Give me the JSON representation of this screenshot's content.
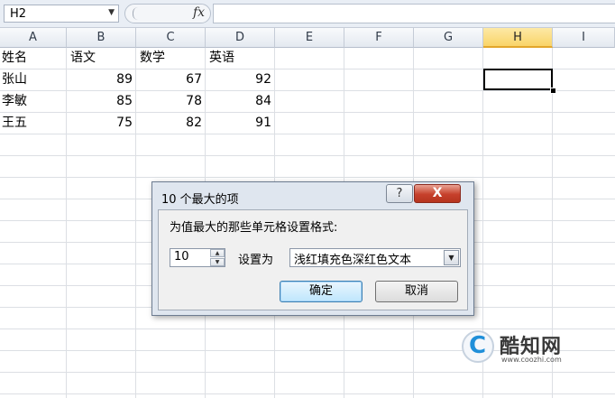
{
  "formula_bar": {
    "name_box": "H2",
    "fx_label": "fx"
  },
  "columns": [
    "A",
    "B",
    "C",
    "D",
    "E",
    "F",
    "G",
    "H",
    "I"
  ],
  "selected_column": "H",
  "sheet": {
    "header_row": [
      "姓名",
      "语文",
      "数学",
      "英语"
    ],
    "rows": [
      [
        "张山",
        "89",
        "67",
        "92"
      ],
      [
        "李敏",
        "85",
        "78",
        "84"
      ],
      [
        "王五",
        "75",
        "82",
        "91"
      ]
    ]
  },
  "dialog": {
    "title": "10 个最大的项",
    "help_label": "?",
    "close_label": "X",
    "prompt": "为值最大的那些单元格设置格式:",
    "count_value": "10",
    "set_as_label": "设置为",
    "format_value": "浅红填充色深红色文本",
    "ok_label": "确定",
    "cancel_label": "取消"
  },
  "watermark": {
    "glyph": "C",
    "brand": "酷知网",
    "url": "www.coozhi.com"
  }
}
